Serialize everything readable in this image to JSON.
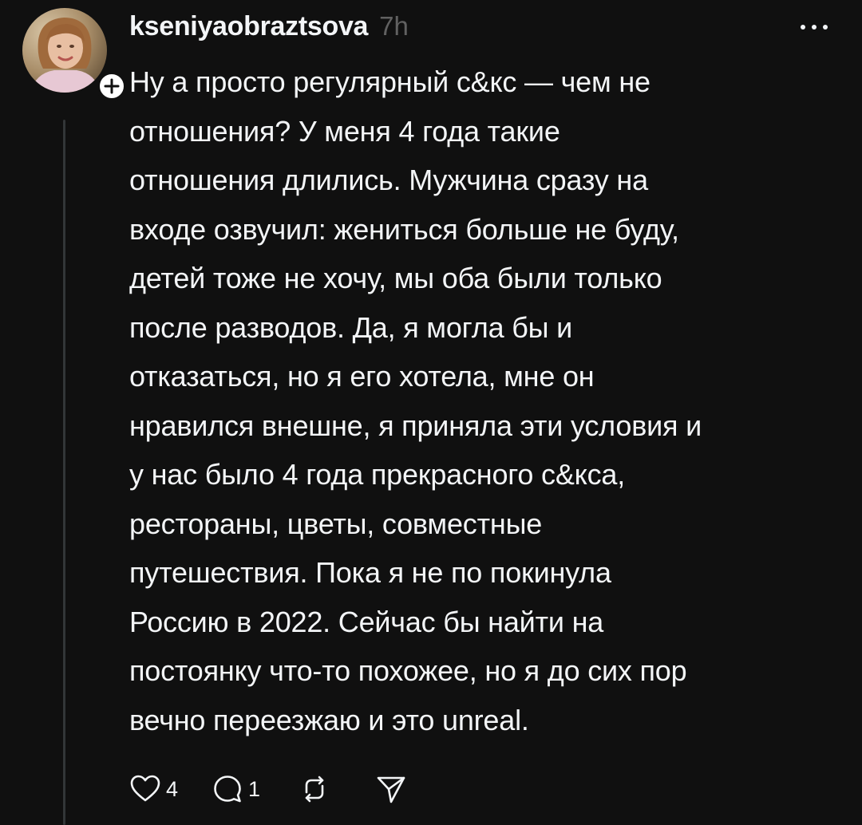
{
  "post": {
    "username": "kseniyaobraztsova",
    "timestamp": "7h",
    "text": "Ну а просто регулярный с&кс — чем не\nотношения? У меня 4 года такие\nотношения длились. Мужчина сразу на\nвходе озвучил: жениться больше не буду,\nдетей тоже не хочу, мы оба были только\nпосле разводов. Да, я могла бы и\nотказаться, но я его хотела, мне он\nнравился внешне, я приняла эти условия и\nу нас было 4 года прекрасного с&кса,\nрестораны, цветы, совместные\nпутешествия. Пока я не по покинула\nРоссию в 2022. Сейчас бы найти на\nпостоянку что-то похожее, но я до сих пор\nвечно переезжаю и это unreal.",
    "likes": "4",
    "replies": "1"
  },
  "icons": {
    "avatar": "profile-photo",
    "follow": "plus-icon",
    "more": "more-horizontal-icon",
    "like": "heart-icon",
    "reply": "comment-icon",
    "repost": "repost-icon",
    "share": "send-icon"
  },
  "colors": {
    "background": "#101010",
    "text": "#f3f5f7",
    "muted": "#616161",
    "thread_line": "#333638"
  }
}
